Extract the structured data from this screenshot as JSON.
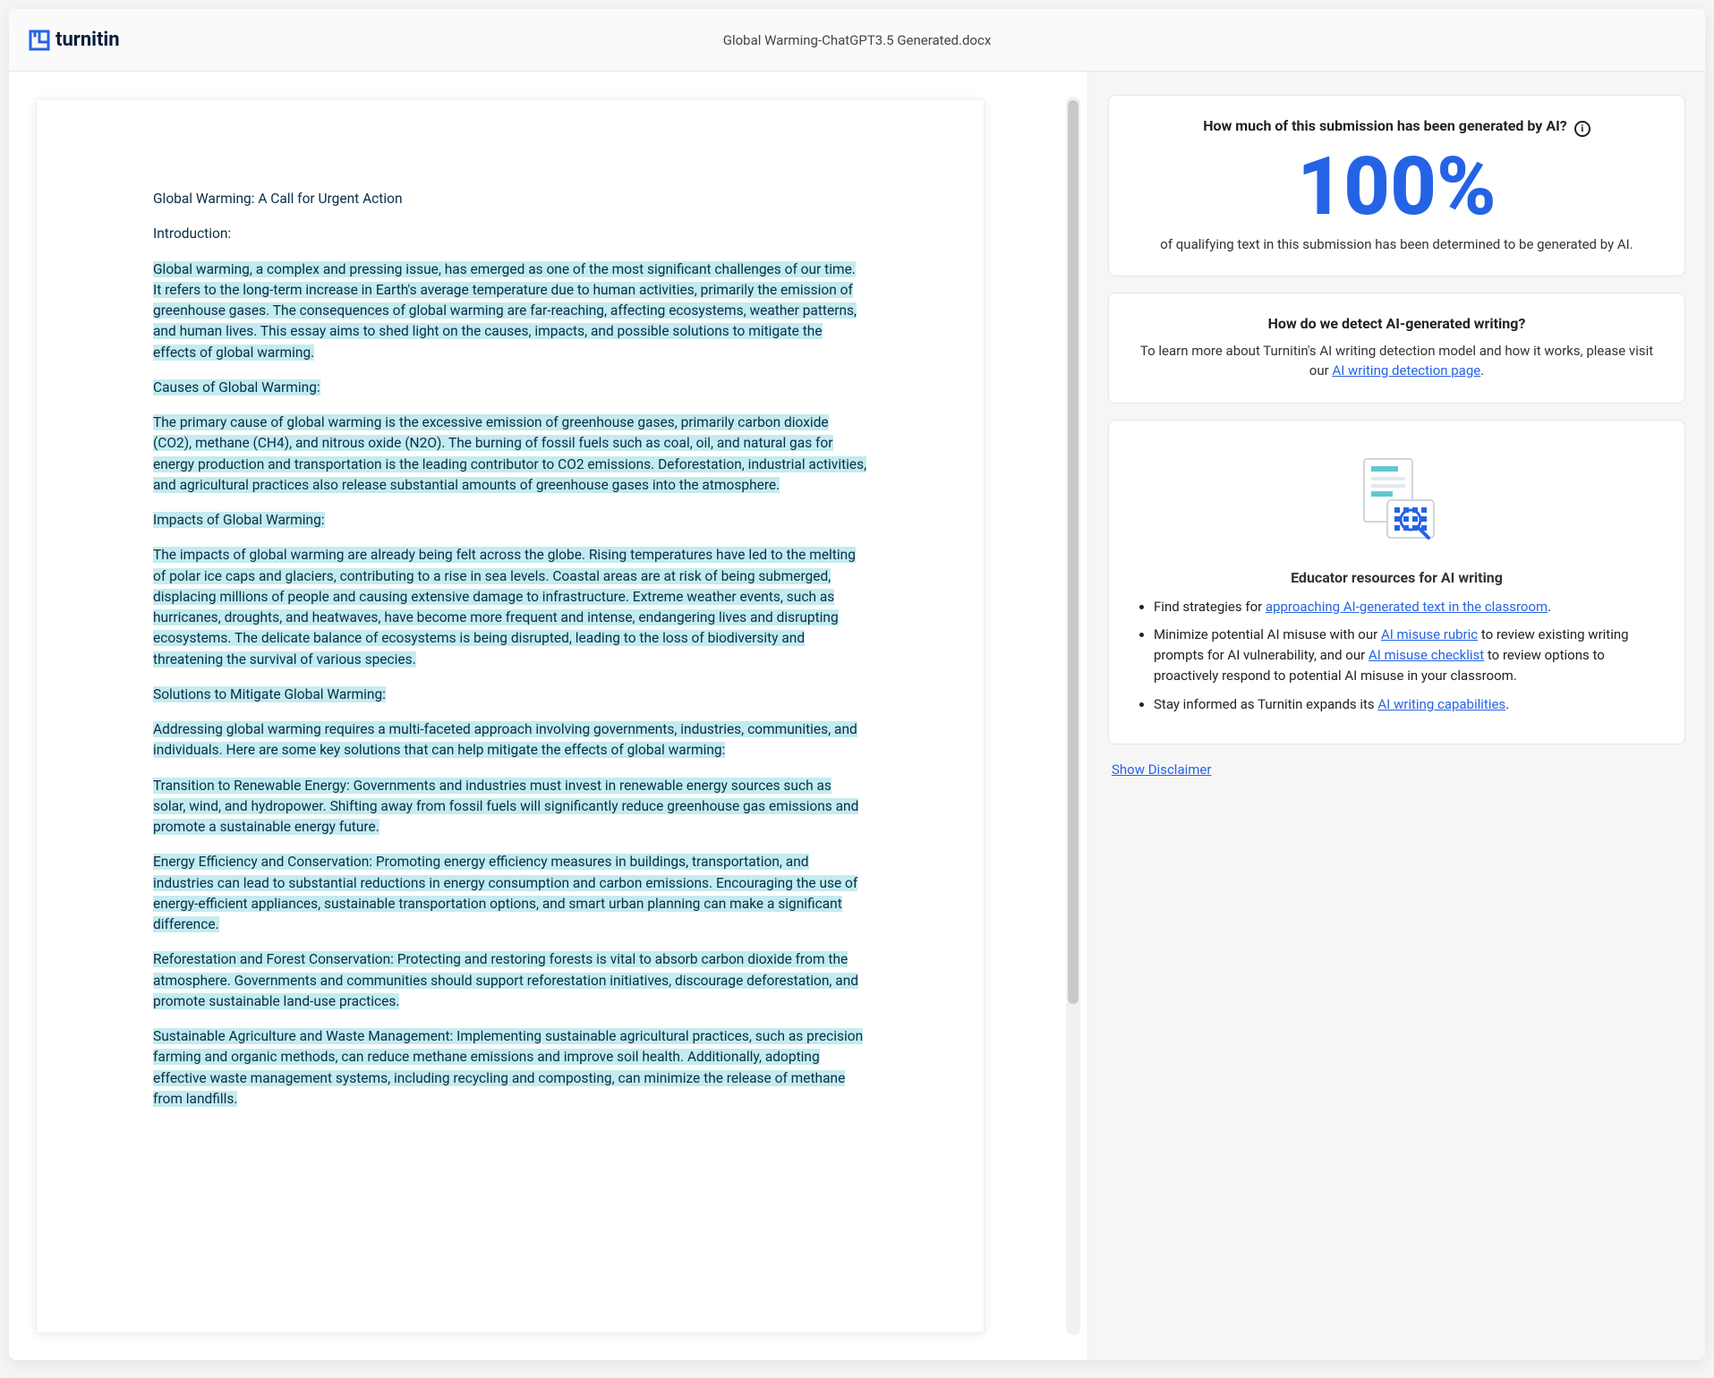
{
  "header": {
    "brand": "turnitin",
    "filename": "Global Warming-ChatGPT3.5 Generated.docx"
  },
  "document": {
    "title": "Global Warming: A Call for Urgent Action",
    "intro_label": "Introduction:",
    "intro_p1": "Global warming, a complex and pressing issue, has emerged as one of the most significant challenges of our time. It refers to the long-term increase in Earth's average temperature due to human activities, primarily the emission of greenhouse gases. The consequences of global warming are far-reaching, affecting ecosystems, weather patterns, and human lives. This essay aims to shed light on the causes, impacts, and possible solutions to mitigate the effects of global warming.",
    "causes_label": "Causes of Global Warming:",
    "causes_p1": "The primary cause of global warming is the excessive emission of greenhouse gases, primarily carbon dioxide (CO2), methane (CH4), and nitrous oxide (N2O). The burning of fossil fuels such as coal, oil, and natural gas for energy production and transportation is the leading contributor to CO2 emissions. Deforestation, industrial activities, and agricultural practices also release substantial amounts of greenhouse gases into the atmosphere.",
    "impacts_label": "Impacts of Global Warming:",
    "impacts_p1": "The impacts of global warming are already being felt across the globe. Rising temperatures have led to the melting of polar ice caps and glaciers, contributing to a rise in sea levels. Coastal areas are at risk of being submerged, displacing millions of people and causing extensive damage to infrastructure. Extreme weather events, such as hurricanes, droughts, and heatwaves, have become more frequent and intense, endangering lives and disrupting ecosystems. The delicate balance of ecosystems is being disrupted, leading to the loss of biodiversity and threatening the survival of various species.",
    "solutions_label": "Solutions to Mitigate Global Warming:",
    "solutions_p1": "Addressing global warming requires a multi-faceted approach involving governments, industries, communities, and individuals. Here are some key solutions that can help mitigate the effects of global warming:",
    "sol_a": "Transition to Renewable Energy: Governments and industries must invest in renewable energy sources such as solar, wind, and hydropower. Shifting away from fossil fuels will significantly reduce greenhouse gas emissions and promote a sustainable energy future.",
    "sol_b": "Energy Efficiency and Conservation: Promoting energy efficiency measures in buildings, transportation, and industries can lead to substantial reductions in energy consumption and carbon emissions. Encouraging the use of energy-efficient appliances, sustainable transportation options, and smart urban planning can make a significant difference.",
    "sol_c": "Reforestation and Forest Conservation: Protecting and restoring forests is vital to absorb carbon dioxide from the atmosphere. Governments and communities should support reforestation initiatives, discourage deforestation, and promote sustainable land-use practices.",
    "sol_d": "Sustainable Agriculture and Waste Management: Implementing sustainable agricultural practices, such as precision farming and organic methods, can reduce methane emissions and improve soil health. Additionally, adopting effective waste management systems, including recycling and composting, can minimize the release of methane from landfills."
  },
  "sidebar": {
    "score_card": {
      "title": "How much of this submission has been generated by AI?",
      "score": "100%",
      "subtext": "of qualifying text in this submission has been determined to be generated by AI."
    },
    "detect_card": {
      "title": "How do we detect AI-generated writing?",
      "body_prefix": "To learn more about Turnitin's AI writing detection model and how it works, please visit our ",
      "link": "AI writing detection page",
      "body_suffix": "."
    },
    "resources_card": {
      "title": "Educator resources for AI writing",
      "items": {
        "0": {
          "pre": "Find strategies for ",
          "link": "approaching AI-generated text in the classroom",
          "post": "."
        },
        "1": {
          "pre": "Minimize potential AI misuse with our ",
          "link1": "AI misuse rubric",
          "mid": " to review existing writing prompts for AI vulnerability, and our ",
          "link2": "AI misuse checklist",
          "post": " to review options to proactively respond to potential AI misuse in your classroom."
        },
        "2": {
          "pre": "Stay informed as Turnitin expands its ",
          "link": "AI writing capabilities",
          "post": "."
        }
      }
    },
    "disclaimer": "Show Disclaimer"
  }
}
